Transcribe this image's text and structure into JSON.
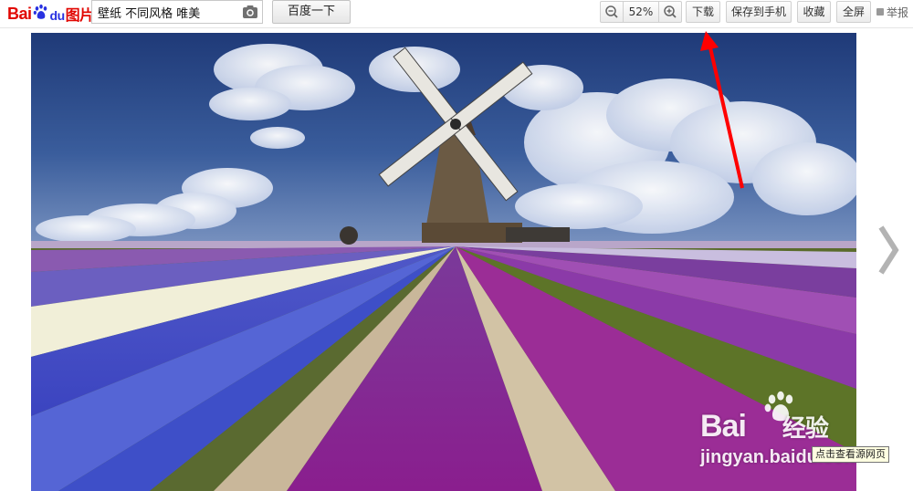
{
  "header": {
    "logo": {
      "bai": "Bai",
      "du": "du",
      "tupian": "图片"
    },
    "search": {
      "value": "壁纸 不同风格 唯美",
      "button_label": "百度一下"
    },
    "toolbar": {
      "zoom_level": "52%",
      "download_label": "下载",
      "save_to_phone_label": "保存到手机",
      "favorite_label": "收藏",
      "fullscreen_label": "全屏",
      "report_label": "举报"
    }
  },
  "viewer": {
    "watermark": {
      "brand": "Bai",
      "brand_end": "经验",
      "domain": "jingyan.baidu.com"
    },
    "tooltip": "点击查看源网页"
  },
  "colors": {
    "brand_red": "#e10601",
    "brand_blue": "#2932e1",
    "annotation_arrow": "#ff0000"
  },
  "icons": [
    "camera-icon",
    "zoom-out-icon",
    "zoom-in-icon",
    "report-flag-icon",
    "next-arrow-icon",
    "baidu-paw-icon"
  ]
}
